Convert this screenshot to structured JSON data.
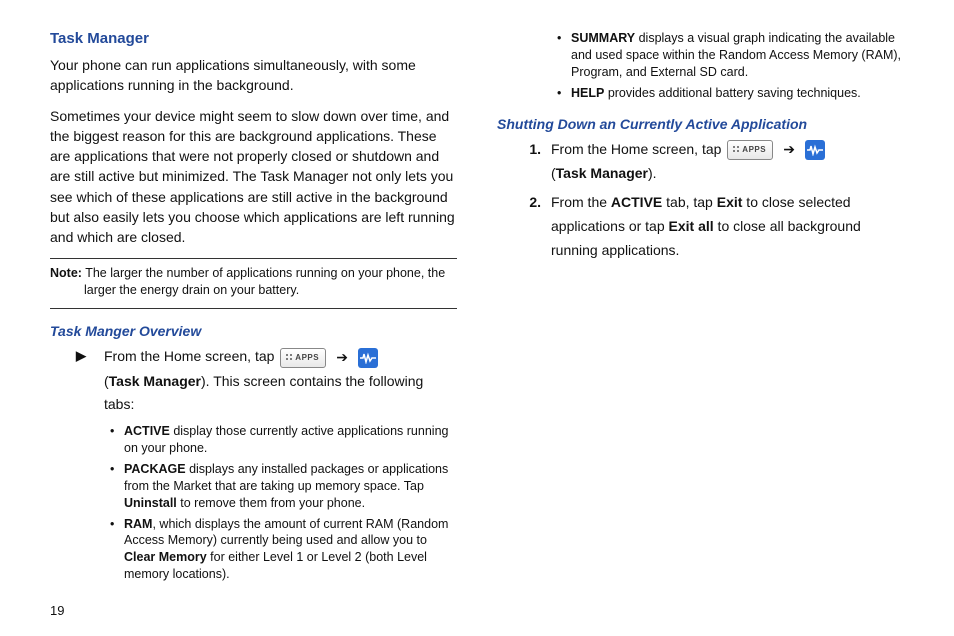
{
  "page_number": "19",
  "section_title": "Task Manager",
  "intro_p1": "Your phone can run applications simultaneously, with some applications running in the background.",
  "intro_p2": "Sometimes your device might seem to slow down over time, and the biggest reason for this are background applications. These are applications that were not properly closed or shutdown and are still active but minimized. The Task Manager not only lets you see which of these applications are still active in the background but also easily lets you choose which applications are left running and which are closed.",
  "note_label": "Note:",
  "note_text": "The larger the number of applications running on your phone, the larger the energy drain on your battery.",
  "overview_heading": "Task Manger Overview",
  "ov_arrow": "▶",
  "ov_text_a": "From the Home screen, tap ",
  "icon_apps_label": "APPS",
  "arrow_glyph": "➔",
  "ov_text_b_pre": "(",
  "ov_tm_bold": "Task Manager",
  "ov_text_b_post": "). This screen contains the following tabs:",
  "bullets": [
    {
      "bold": "ACTIVE",
      "rest": " display those currently active applications running on your phone."
    },
    {
      "bold": "PACKAGE",
      "rest": " displays any installed packages or applications from the Market that are taking up memory space. Tap ",
      "bold2": "Uninstall",
      "rest2": " to remove them from your phone."
    },
    {
      "bold": "RAM",
      "rest": ", which displays the amount of current RAM (Random Access Memory) currently being used and allow you to ",
      "bold2": "Clear Memory",
      "rest2": " for either Level 1 or Level 2 (both Level memory locations)."
    },
    {
      "bold": "SUMMARY",
      "rest": " displays a visual graph indicating the available and used space within the Random Access Memory (RAM), Program, and External SD card."
    },
    {
      "bold": "HELP",
      "rest": " provides additional battery saving techniques."
    }
  ],
  "shutdown_heading": "Shutting Down an Currently Active Application",
  "sd_steps": [
    {
      "num": "1.",
      "pre": "From the Home screen, tap ",
      "line2_pre": "(",
      "tm_bold": "Task Manager",
      "line2_post": ")."
    },
    {
      "num": "2.",
      "pre": "From the ",
      "b1": "ACTIVE",
      "mid1": " tab, tap ",
      "b2": "Exit",
      "mid2": " to close selected applications or tap ",
      "b3": "Exit all",
      "mid3": " to close all background running applications."
    }
  ]
}
